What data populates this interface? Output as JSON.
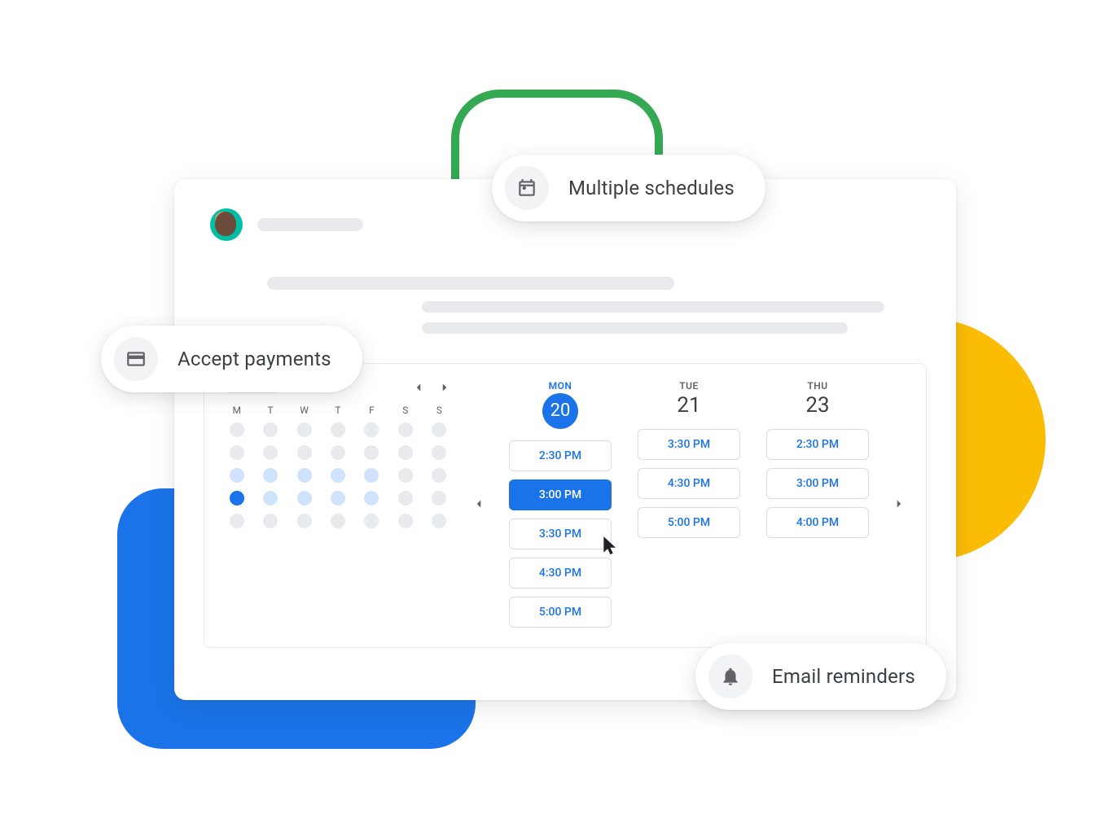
{
  "pills": {
    "schedules": "Multiple schedules",
    "payments": "Accept payments",
    "reminders": "Email reminders"
  },
  "minical": {
    "dow": [
      "M",
      "T",
      "W",
      "T",
      "F",
      "S",
      "S"
    ],
    "weeks": [
      [
        "g",
        "g",
        "g",
        "g",
        "g",
        "g",
        "g"
      ],
      [
        "g",
        "g",
        "g",
        "g",
        "g",
        "g",
        "g"
      ],
      [
        "lb",
        "lb",
        "lb",
        "lb",
        "lb",
        "g",
        "g"
      ],
      [
        "b",
        "lb",
        "lb",
        "lb",
        "lb",
        "g",
        "g"
      ],
      [
        "g",
        "g",
        "g",
        "g",
        "g",
        "g",
        "g"
      ]
    ]
  },
  "days": [
    {
      "label": "MON",
      "num": "20",
      "active": true,
      "slots": [
        "2:30 PM",
        "3:00 PM",
        "3:30 PM",
        "4:30 PM",
        "5:00 PM"
      ],
      "selected": "3:00 PM"
    },
    {
      "label": "TUE",
      "num": "21",
      "active": false,
      "slots": [
        "3:30 PM",
        "4:30 PM",
        "5:00 PM"
      ],
      "selected": null
    },
    {
      "label": "THU",
      "num": "23",
      "active": false,
      "slots": [
        "2:30 PM",
        "3:00 PM",
        "4:00 PM"
      ],
      "selected": null
    }
  ]
}
